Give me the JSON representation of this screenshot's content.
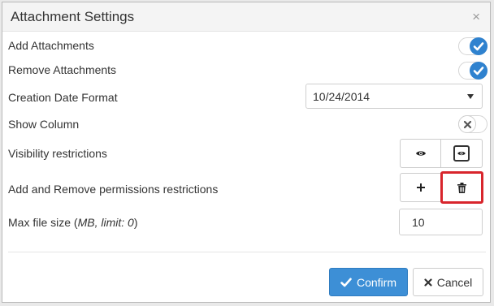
{
  "dialog": {
    "title": "Attachment Settings",
    "close_symbol": "×"
  },
  "rows": {
    "add_attachments": {
      "label": "Add Attachments",
      "enabled": true
    },
    "remove_attachments": {
      "label": "Remove Attachments",
      "enabled": true
    },
    "creation_date_format": {
      "label": "Creation Date Format",
      "value": "10/24/2014"
    },
    "show_column": {
      "label": "Show Column",
      "enabled": false
    },
    "visibility_restrictions": {
      "label": "Visibility restrictions",
      "icons": [
        "eye-icon",
        "eye-boxed-icon"
      ]
    },
    "add_remove_permissions": {
      "label": "Add and Remove permissions restrictions",
      "icons": [
        "plus-icon",
        "trash-icon"
      ]
    },
    "max_file_size": {
      "label_prefix": "Max file size (",
      "label_hint": "MB, limit: 0",
      "label_suffix": ")",
      "value": "10"
    }
  },
  "footer": {
    "confirm_label": "Confirm",
    "cancel_label": "Cancel"
  },
  "colors": {
    "accent": "#2f82cf",
    "confirm_bg": "#3d8fd6",
    "highlight": "#d8252c"
  }
}
